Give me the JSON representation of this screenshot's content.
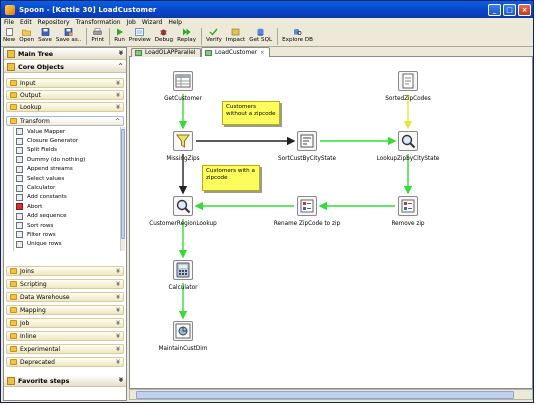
{
  "window": {
    "title": "Spoon - [Kettle 30] LoadCustomer"
  },
  "menu": [
    "File",
    "Edit",
    "Repository",
    "Transformation",
    "Job",
    "Wizard",
    "Help"
  ],
  "toolbar": [
    {
      "label": "New",
      "icon": "new-file-icon"
    },
    {
      "label": "Open",
      "icon": "open-folder-icon"
    },
    {
      "label": "Save",
      "icon": "save-icon"
    },
    {
      "label": "Save as..",
      "icon": "save-as-icon"
    },
    {
      "label": "Print",
      "icon": "print-icon"
    },
    {
      "label": "Run",
      "icon": "run-icon"
    },
    {
      "label": "Preview",
      "icon": "preview-icon"
    },
    {
      "label": "Debug",
      "icon": "debug-icon"
    },
    {
      "label": "Replay",
      "icon": "replay-icon"
    },
    {
      "label": "Verify",
      "icon": "verify-icon"
    },
    {
      "label": "Impact",
      "icon": "impact-icon"
    },
    {
      "label": "Get SQL",
      "icon": "sql-icon"
    },
    {
      "label": "Explore DB",
      "icon": "explore-db-icon"
    }
  ],
  "left": {
    "main_tree": "Main Tree",
    "core_objects": "Core Objects",
    "categories_top": [
      "Input",
      "Output",
      "Lookup",
      "Transform"
    ],
    "transform_steps": [
      "Value Mapper",
      "Closure Generator",
      "Split Fields",
      "Dummy (do nothing)",
      "Append streams",
      "Select values",
      "Calculator",
      "Add constants",
      "Abort",
      "Add sequence",
      "Sort rows",
      "Filter rows",
      "Unique rows"
    ],
    "categories_bottom": [
      "Joins",
      "Scripting",
      "Data Warehouse",
      "Mapping",
      "Job",
      "Inline",
      "Experimental",
      "Deprecated"
    ],
    "favorite_steps": "Favorite steps"
  },
  "tabs": [
    {
      "label": "LoadOLAPParallel",
      "active": false
    },
    {
      "label": "LoadCustomer",
      "active": true
    }
  ],
  "canvas": {
    "notes": [
      {
        "text": "Customers without a zipcode"
      },
      {
        "text": "Customers with a zipcode"
      }
    ],
    "steps": [
      {
        "id": "GetCustomer",
        "label": "GetCustomer",
        "icon": "table-input-icon"
      },
      {
        "id": "MissingZips",
        "label": "MissingZips",
        "icon": "filter-icon"
      },
      {
        "id": "SortCustByCityState",
        "label": "SortCustByCityState",
        "icon": "sort-icon"
      },
      {
        "id": "LookupZipByCityState",
        "label": "LookupZipbyCityState",
        "icon": "lookup-icon"
      },
      {
        "id": "SortedZipCodes",
        "label": "SortedZipCodes",
        "icon": "text-file-icon"
      },
      {
        "id": "RemoveZip",
        "label": "Remove zip",
        "icon": "select-values-icon"
      },
      {
        "id": "RenameZip",
        "label": "Rename ZipCode to zip",
        "icon": "select-values-icon"
      },
      {
        "id": "CustomerRegionLookup",
        "label": "CustomerRegionLookup",
        "icon": "lookup-icon"
      },
      {
        "id": "Calculator",
        "label": "Calculator",
        "icon": "calculator-icon"
      },
      {
        "id": "MaintainCustDim",
        "label": "MaintainCustDim",
        "icon": "dimension-icon"
      }
    ],
    "hops": [
      {
        "from": "GetCustomer",
        "to": "MissingZips",
        "color": "#33dd33"
      },
      {
        "from": "MissingZips",
        "to": "SortCustByCityState",
        "color": "#222222"
      },
      {
        "from": "MissingZips",
        "to": "CustomerRegionLookup",
        "color": "#222222"
      },
      {
        "from": "SortCustByCityState",
        "to": "LookupZipByCityState",
        "color": "#33dd33"
      },
      {
        "from": "SortedZipCodes",
        "to": "LookupZipByCityState",
        "color": "#e8e830"
      },
      {
        "from": "LookupZipByCityState",
        "to": "RemoveZip",
        "color": "#33dd33"
      },
      {
        "from": "RemoveZip",
        "to": "RenameZip",
        "color": "#33dd33"
      },
      {
        "from": "RenameZip",
        "to": "CustomerRegionLookup",
        "color": "#33dd33"
      },
      {
        "from": "CustomerRegionLookup",
        "to": "Calculator",
        "color": "#33dd33"
      },
      {
        "from": "Calculator",
        "to": "MaintainCustDim",
        "color": "#33dd33"
      }
    ]
  }
}
